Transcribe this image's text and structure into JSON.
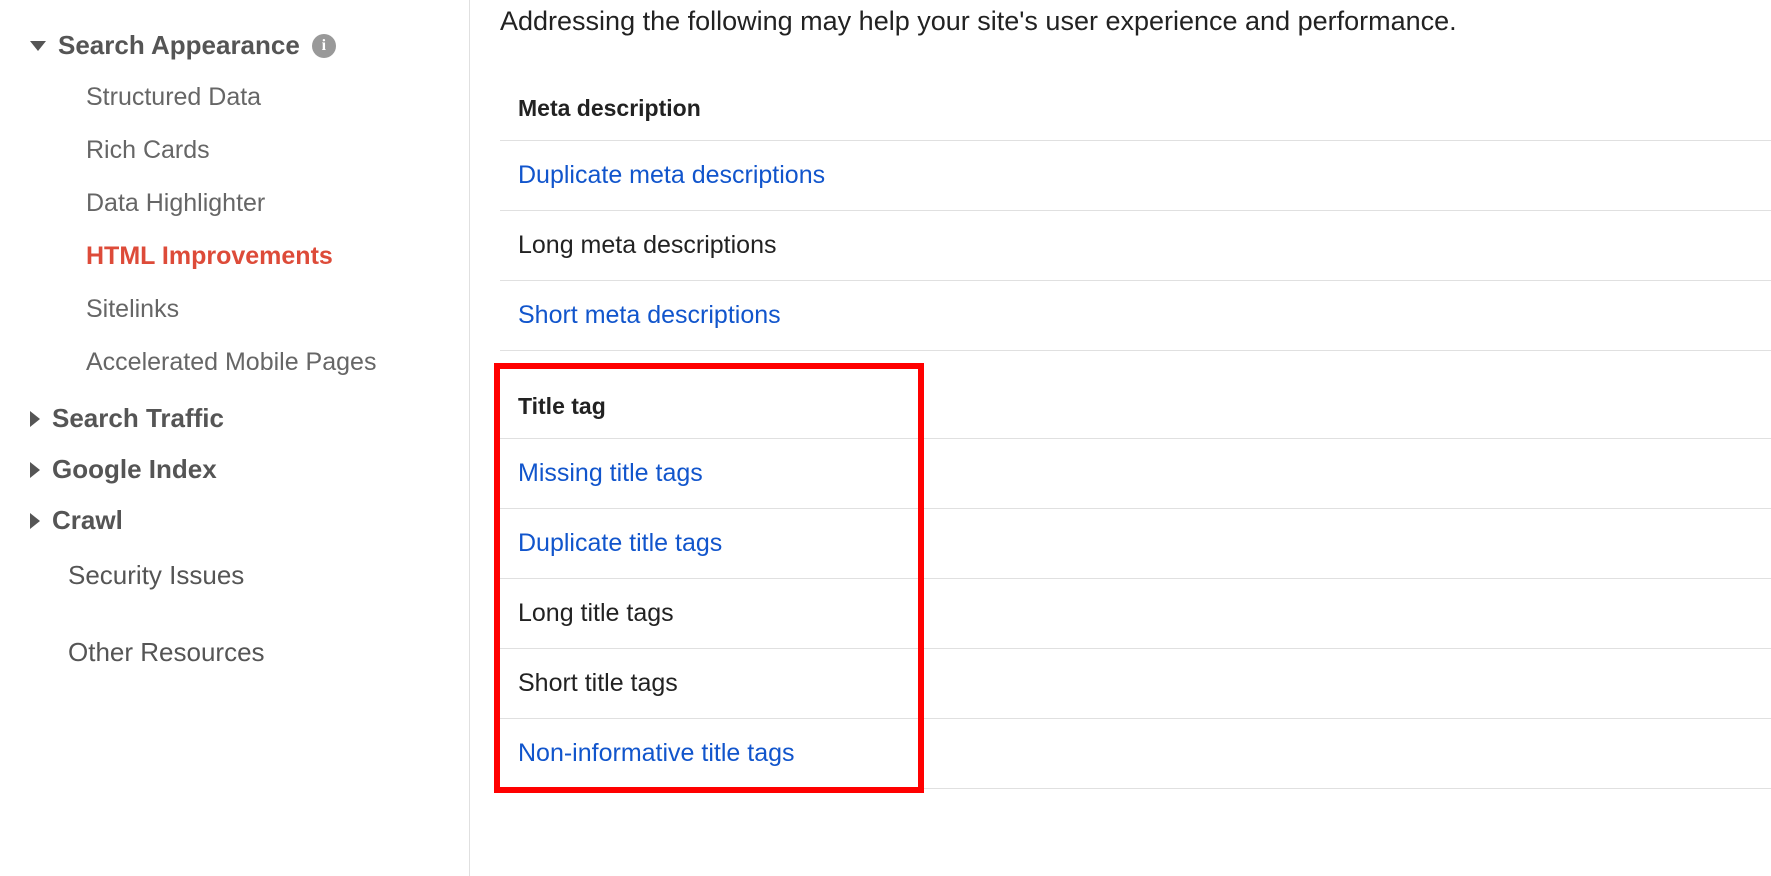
{
  "sidebar": {
    "sections": {
      "searchAppearance": {
        "label": "Search Appearance",
        "items": [
          {
            "label": "Structured Data"
          },
          {
            "label": "Rich Cards"
          },
          {
            "label": "Data Highlighter"
          },
          {
            "label": "HTML Improvements"
          },
          {
            "label": "Sitelinks"
          },
          {
            "label": "Accelerated Mobile Pages"
          }
        ]
      },
      "searchTraffic": {
        "label": "Search Traffic"
      },
      "googleIndex": {
        "label": "Google Index"
      },
      "crawl": {
        "label": "Crawl"
      },
      "securityIssues": {
        "label": "Security Issues"
      },
      "otherResources": {
        "label": "Other Resources"
      }
    }
  },
  "main": {
    "intro": "Addressing the following may help your site's user experience and performance.",
    "metaSection": {
      "title": "Meta description",
      "items": [
        {
          "label": "Duplicate meta descriptions",
          "link": true
        },
        {
          "label": "Long meta descriptions",
          "link": false
        },
        {
          "label": "Short meta descriptions",
          "link": true
        }
      ]
    },
    "titleSection": {
      "title": "Title tag",
      "items": [
        {
          "label": "Missing title tags",
          "link": true
        },
        {
          "label": "Duplicate title tags",
          "link": true
        },
        {
          "label": "Long title tags",
          "link": false
        },
        {
          "label": "Short title tags",
          "link": false
        },
        {
          "label": "Non-informative title tags",
          "link": true
        }
      ]
    }
  }
}
